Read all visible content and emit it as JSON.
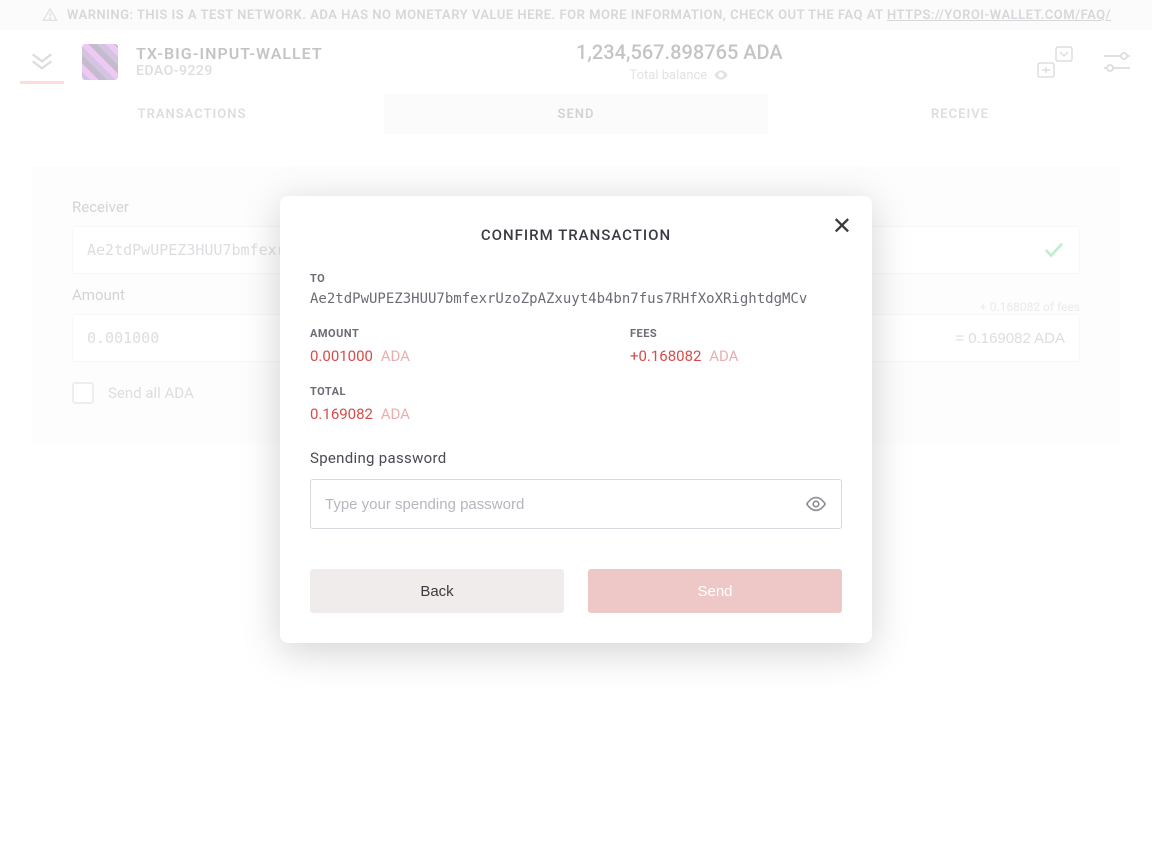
{
  "warning": {
    "prefix": "WARNING: THIS IS A TEST NETWORK. ADA HAS NO MONETARY VALUE HERE. FOR MORE INFORMATION, CHECK OUT THE FAQ AT ",
    "link": "HTTPS://YOROI-WALLET.COM/FAQ/"
  },
  "header": {
    "wallet_name": "TX-BIG-INPUT-WALLET",
    "wallet_plate": "EDAO-9229",
    "balance": "1,234,567.898765 ADA",
    "balance_label": "Total balance"
  },
  "tabs": {
    "transactions": "TRANSACTIONS",
    "send": "SEND",
    "receive": "RECEIVE"
  },
  "send_form": {
    "receiver_label": "Receiver",
    "receiver_value": "Ae2tdPwUPEZ3HUU7bmfexr",
    "amount_label": "Amount",
    "amount_value": "0.001000",
    "fees_hint": "+ 0.168082 of fees",
    "total_eq": "= 0.169082 ADA",
    "send_all": "Send all ADA"
  },
  "modal": {
    "title": "CONFIRM TRANSACTION",
    "to_label": "TO",
    "to_value": "Ae2tdPwUPEZ3HUU7bmfexrUzoZpAZxuyt4b4bn7fus7RHfXoXRightdgMCv",
    "amount_label": "AMOUNT",
    "amount_value": "0.001000",
    "amount_unit": "ADA",
    "fees_label": "FEES",
    "fees_value": "+0.168082",
    "fees_unit": "ADA",
    "total_label": "TOTAL",
    "total_value": "0.169082",
    "total_unit": "ADA",
    "pw_label": "Spending password",
    "pw_placeholder": "Type your spending password",
    "back": "Back",
    "send": "Send"
  }
}
